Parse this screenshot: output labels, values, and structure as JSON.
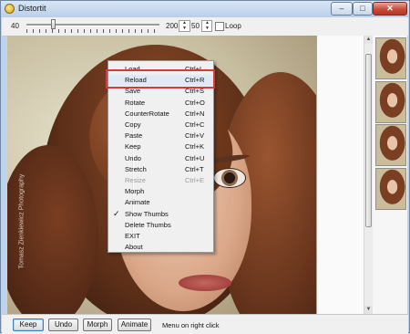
{
  "window": {
    "title": "Distortit",
    "minimize": "–",
    "maximize": "□",
    "close": "✕"
  },
  "toolbar": {
    "min_label": "40",
    "max_value": "200",
    "fps_value": "50",
    "loop_label": "Loop",
    "loop_checked": false,
    "spin_up": "▲",
    "spin_down": "▼"
  },
  "photo": {
    "watermark": "Tomasz Zienkiewicz Photography"
  },
  "context_menu": {
    "items": [
      {
        "label": "Load",
        "shortcut": "Ctrl+L",
        "enabled": true
      },
      {
        "label": "Reload",
        "shortcut": "Ctrl+R",
        "enabled": true,
        "highlighted": true
      },
      {
        "label": "Save",
        "shortcut": "Ctrl+S",
        "enabled": true
      },
      {
        "label": "Rotate",
        "shortcut": "Ctrl+O",
        "enabled": true
      },
      {
        "label": "CounterRotate",
        "shortcut": "Ctrl+N",
        "enabled": true
      },
      {
        "label": "Copy",
        "shortcut": "Ctrl+C",
        "enabled": true
      },
      {
        "label": "Paste",
        "shortcut": "Ctrl+V",
        "enabled": true
      },
      {
        "label": "Keep",
        "shortcut": "Ctrl+K",
        "enabled": true
      },
      {
        "label": "Undo",
        "shortcut": "Ctrl+U",
        "enabled": true
      },
      {
        "label": "Stretch",
        "shortcut": "Ctrl+T",
        "enabled": true
      },
      {
        "label": "Resize",
        "shortcut": "Ctrl+E",
        "enabled": false
      },
      {
        "label": "Morph",
        "shortcut": "",
        "enabled": true
      },
      {
        "label": "Animate",
        "shortcut": "",
        "enabled": true
      },
      {
        "label": "Show Thumbs",
        "shortcut": "",
        "enabled": true,
        "checked": true
      },
      {
        "label": "Delete Thumbs",
        "shortcut": "",
        "enabled": true
      },
      {
        "label": "EXIT",
        "shortcut": "",
        "enabled": true
      },
      {
        "label": "About",
        "shortcut": "",
        "enabled": true
      }
    ],
    "check_glyph": "✓"
  },
  "scrollbar": {
    "up_glyph": "▲",
    "down_glyph": "▼"
  },
  "bottom": {
    "keep_label": "Keep",
    "undo_label": "Undo",
    "morph_label": "Morph",
    "animate_label": "Animate",
    "hint": "Menu on right click"
  },
  "colors": {
    "highlight_box": "#d63a3a",
    "menu_bg": "#f0f0f0",
    "window_frame": "#bfd3ea"
  }
}
